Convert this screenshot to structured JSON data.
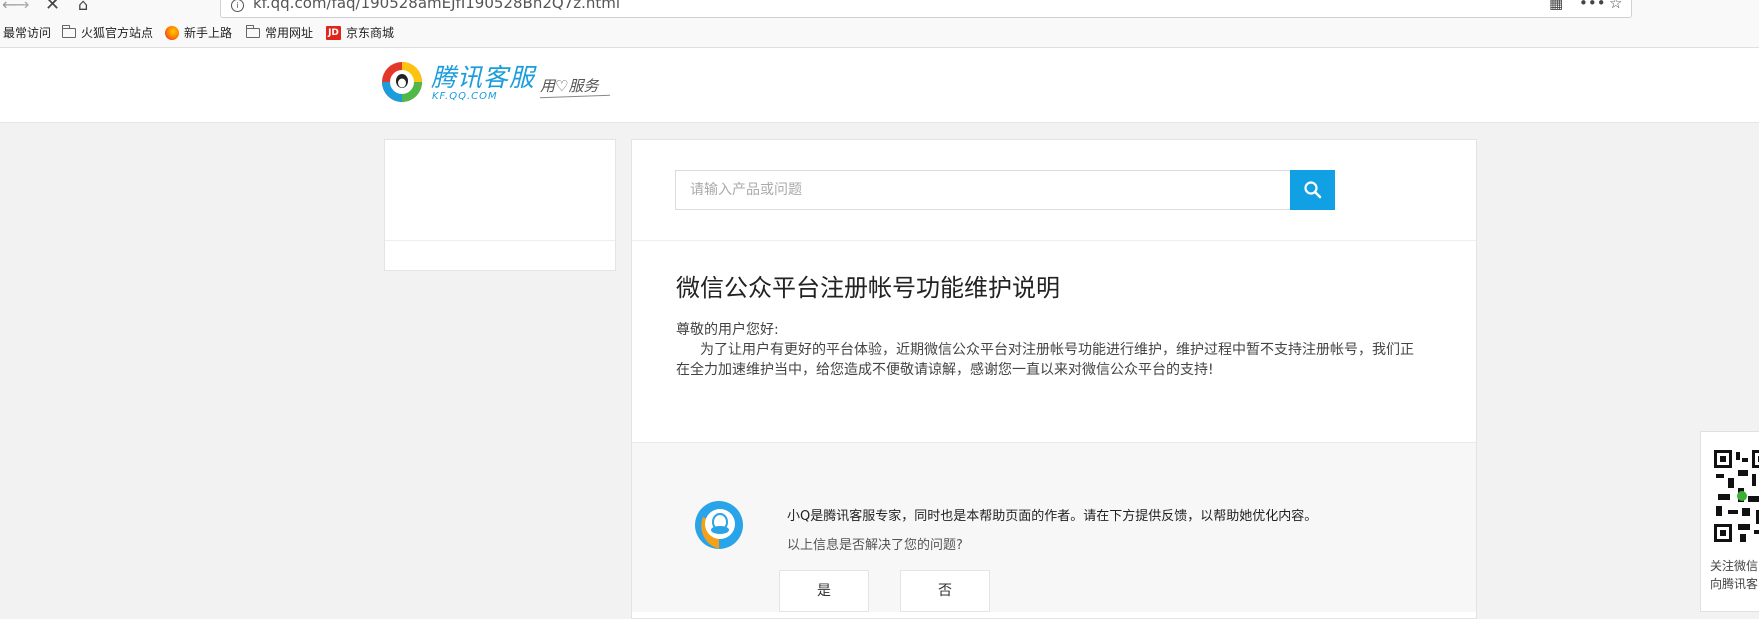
{
  "browser": {
    "url": "kf.qq.com/faq/190528amEJfI190528Bn2Q7z.html",
    "bookmarks": [
      {
        "label": "最常访问",
        "icon": "none"
      },
      {
        "label": "火狐官方站点",
        "icon": "folder-icon"
      },
      {
        "label": "新手上路",
        "icon": "firefox-icon"
      },
      {
        "label": "常用网址",
        "icon": "folder-icon"
      },
      {
        "label": "京东商城",
        "icon": "jd-icon",
        "icon_text": "JD"
      }
    ]
  },
  "header": {
    "brand": "腾讯客服",
    "brand_sub": "KF.QQ.COM",
    "slogan": "用♡服务"
  },
  "search": {
    "placeholder": "请输入产品或问题",
    "value": ""
  },
  "article": {
    "title": "微信公众平台注册帐号功能维护说明",
    "greeting": "尊敬的用户您好:",
    "body": "为了让用户有更好的平台体验，近期微信公众平台对注册帐号功能进行维护，维护过程中暂不支持注册帐号，我们正在全力加速维护当中，给您造成不便敬请谅解，感谢您一直以来对微信公众平台的支持!"
  },
  "feedback": {
    "intro": "小Q是腾讯客服专家，同时也是本帮助页面的作者。请在下方提供反馈，以帮助她优化内容。",
    "question": "以上信息是否解决了您的问题?",
    "yes_label": "是",
    "no_label": "否"
  },
  "qr_widget": {
    "line1": "关注微信",
    "line2": "向腾讯客"
  },
  "colors": {
    "accent": "#11a0e4",
    "brand": "#1a9cdd"
  }
}
